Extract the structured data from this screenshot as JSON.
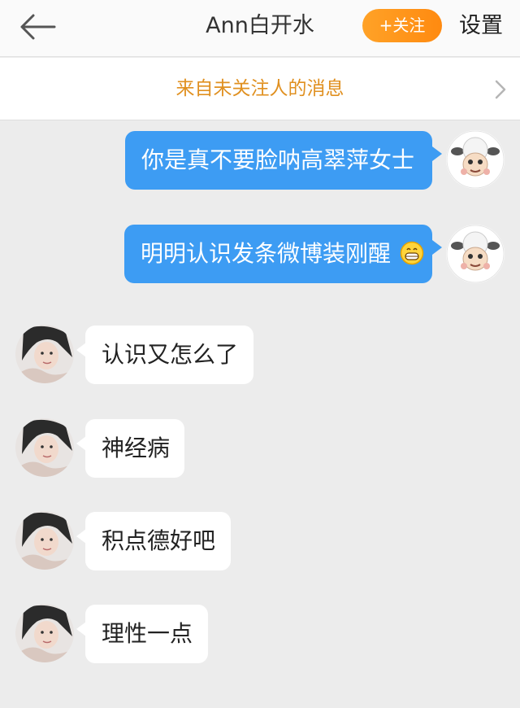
{
  "header": {
    "title": "Ann白开水",
    "follow_label": "+关注",
    "settings_label": "设置"
  },
  "notice": {
    "text": "来自未关注人的消息"
  },
  "messages": [
    {
      "direction": "out",
      "text": "你是真不要脸呐高翠萍女士"
    },
    {
      "direction": "out",
      "text": "明明认识发条微博装刚醒",
      "emoji": "grinning-face-emoji"
    },
    {
      "direction": "in",
      "text": "认识又怎么了"
    },
    {
      "direction": "in",
      "text": "神经病"
    },
    {
      "direction": "in",
      "text": "积点德好吧"
    },
    {
      "direction": "in",
      "text": "理性一点"
    }
  ],
  "colors": {
    "outgoing_bubble": "#3d9cf3",
    "incoming_bubble": "#ffffff",
    "follow_button": "#ff9a1f",
    "notice_text": "#e09020",
    "background": "#ececec"
  }
}
